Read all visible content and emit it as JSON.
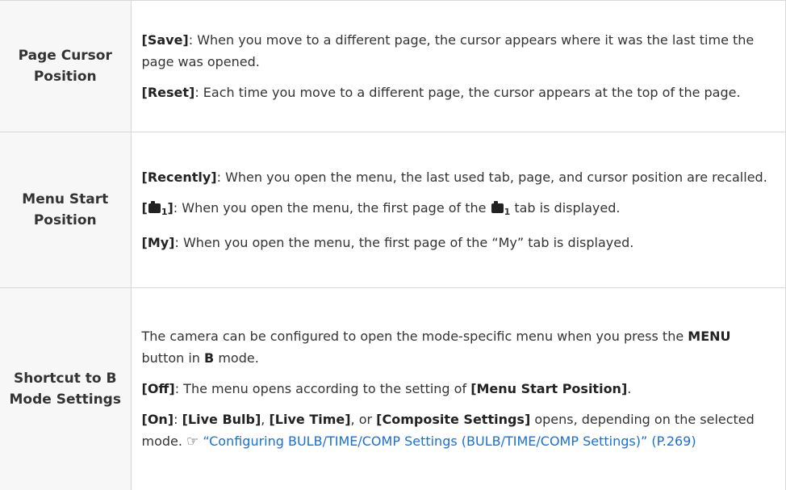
{
  "rows": [
    {
      "label": "Page Cursor Position",
      "items": [
        {
          "key": "[Save]",
          "text": ": When you move to a different page, the cursor appears where it was the last time the page was opened."
        },
        {
          "key": "[Reset]",
          "text": ": Each time you move to a different page, the cursor appears at the top of the page."
        }
      ]
    },
    {
      "label": "Menu Start Position",
      "items": [
        {
          "key": "[Recently]",
          "text": ": When you open the menu, the last used tab, page, and cursor position are recalled."
        },
        {
          "key_open": "[",
          "key_sub": "1",
          "key_close": "]",
          "text_before": ": When you open the menu, the first page of the ",
          "text_sub": "1",
          "text_after": " tab is displayed.",
          "icon": "camera-icon"
        },
        {
          "key": "[My]",
          "text": ": When you open the menu, the first page of the “My” tab is displayed."
        }
      ]
    },
    {
      "label": "Shortcut to B Mode Settings",
      "intro": {
        "t1": "The camera can be configured to open the mode-specific menu when you press the ",
        "b1": "MENU",
        "t2": " button in ",
        "b2": "B",
        "t3": " mode."
      },
      "off": {
        "key": "[Off]",
        "text": ": The menu opens according to the setting of ",
        "bold": "[Menu Start Position]",
        "end": "."
      },
      "on": {
        "key": "[On]",
        "sep1": ": ",
        "b1": "[Live Bulb]",
        "sep2": ", ",
        "b2": "[Live Time]",
        "sep3": ", or ",
        "b3": "[Composite Settings]",
        "text": " opens, depending on the selected mode. ",
        "ref_icon": "☞",
        "link": "“Configuring BULB/TIME/COMP Settings (BULB/TIME/COMP Settings)” (P.269)"
      }
    }
  ]
}
